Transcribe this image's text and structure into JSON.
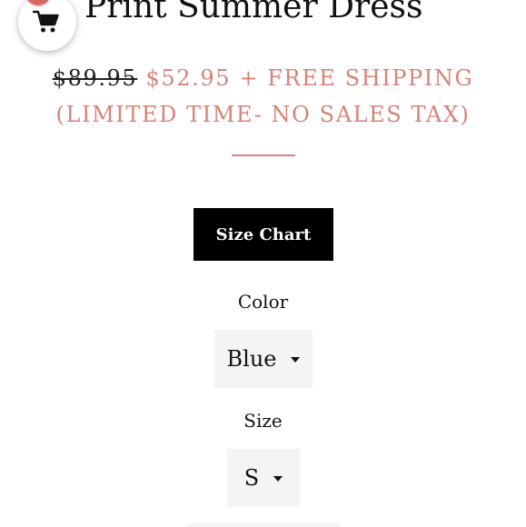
{
  "cart": {
    "count": "0",
    "icon": "cart-icon",
    "badge_color": "#d9665f"
  },
  "product": {
    "title": "Print Summer Dress",
    "old_price": "$89.95",
    "price_line": " $52.95 + FREE SHIPPING",
    "promo_line": "(LIMITED TIME- NO SALES TAX)",
    "accent_color": "#d98278"
  },
  "size_chart": {
    "label": "Size Chart"
  },
  "options": {
    "color": {
      "label": "Color",
      "selected": "Blue"
    },
    "size": {
      "label": "Size",
      "selected": "S"
    }
  }
}
